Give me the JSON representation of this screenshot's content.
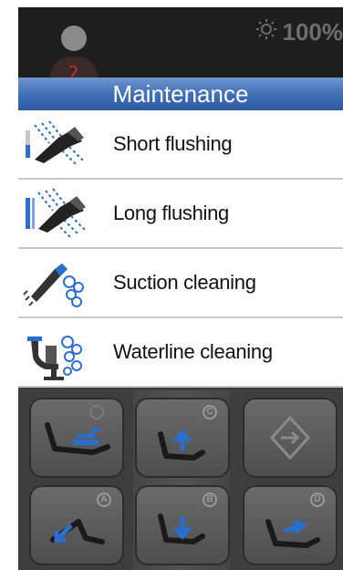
{
  "status": {
    "brightness_icon": "sun-icon",
    "brightness_value": "100%"
  },
  "title": "Maintenance",
  "menu": {
    "items": [
      {
        "label": "Short flushing",
        "icon": "short-flushing-icon"
      },
      {
        "label": "Long flushing",
        "icon": "long-flushing-icon"
      },
      {
        "label": "Suction cleaning",
        "icon": "suction-cleaning-icon"
      },
      {
        "label": "Waterline cleaning",
        "icon": "waterline-cleaning-icon"
      }
    ]
  },
  "controls": {
    "buttons": [
      {
        "name": "chair-rinse-position-button",
        "icon": "chair-rinse-icon",
        "letter": ""
      },
      {
        "name": "chair-up-program-c-button",
        "icon": "chair-up-icon",
        "letter": "C"
      },
      {
        "name": "confirm-enter-button",
        "icon": "enter-icon",
        "letter": ""
      },
      {
        "name": "chair-program-a-button",
        "icon": "chair-recline-icon",
        "letter": "A"
      },
      {
        "name": "chair-down-program-b-button",
        "icon": "chair-down-icon",
        "letter": "B"
      },
      {
        "name": "chair-program-d-button",
        "icon": "chair-return-icon",
        "letter": "D"
      }
    ]
  },
  "colors": {
    "title_bar": "#3f6eb6",
    "accent_blue": "#2a6fd0",
    "panel_dark": "#3e3e3e",
    "header_dark": "#1e1e1e"
  }
}
